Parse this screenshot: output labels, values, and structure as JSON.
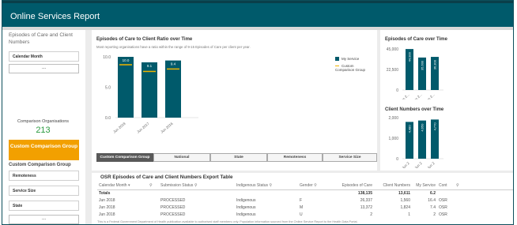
{
  "app": {
    "title": "Online Services Report"
  },
  "left_panel": {
    "episodes_title": "Episodes of Care and Client Numbers",
    "calendar_filter": "Calendar Month",
    "more_label": "...",
    "comparison_label": "Comparison Organisations",
    "comparison_count": "213",
    "custom_button": "Custom Comparison Group",
    "custom_group_title": "Custom Comparison Group",
    "filters": [
      "Remoteness",
      "Service Size",
      "State"
    ]
  },
  "ratio_chart": {
    "title": "Episodes of Care to Client Ratio over Time",
    "subtitle": "Most reporting organisations have a ratio within the range of 9-15 Episodes of Care per client per year.",
    "legend": [
      "My Service",
      "Custom Comparison Group"
    ],
    "colors": {
      "bar": "#005a6b",
      "line": "#f0b400"
    }
  },
  "chart_data": [
    {
      "type": "bar",
      "title": "Episodes of Care to Client Ratio over Time",
      "categories": [
        "Jun 2018",
        "Jun 2017",
        "Jun 2016"
      ],
      "series": [
        {
          "name": "My Service",
          "values": [
            10.0,
            9.1,
            9.4
          ]
        },
        {
          "name": "Custom Comparison Group",
          "values": [
            8.7,
            7.6,
            8.0
          ]
        }
      ],
      "yticks": [
        "10.0",
        "5.0",
        "0.0"
      ],
      "ylim": [
        0,
        10
      ]
    },
    {
      "type": "bar",
      "title": "Episodes of Care over Time",
      "categories": [
        "Jun 2...",
        "Jun 2...",
        "Jun 2..."
      ],
      "values": [
        44900,
        35600,
        36300
      ],
      "value_labels": [
        "44,900",
        "35,600",
        "36,300"
      ],
      "yticks": [
        "45,000",
        "22,500",
        "0"
      ],
      "ylim": [
        0,
        45000
      ]
    },
    {
      "type": "bar",
      "title": "Client Numbers over Time",
      "categories": [
        "Jun 2",
        "Jun 2",
        "Jun 2"
      ],
      "values": [
        4480,
        4650,
        4770
      ],
      "value_labels": [
        "4,480",
        "4,650",
        "4,770"
      ],
      "yticks": [
        "2,000",
        "1,000",
        "0"
      ],
      "ylim": [
        0,
        5000
      ]
    }
  ],
  "tabs": [
    "Custom Comparison Group",
    "National",
    "State",
    "Remoteness",
    "Service Size"
  ],
  "table": {
    "title": "OSR Episodes of Care and Client Numbers Export Table",
    "headers": [
      "Calendar Month",
      "Submission Status",
      "Indigenous Status",
      "Gender",
      "Episodes of Care",
      "Client Numbers",
      "My Service",
      "Cont"
    ],
    "total_row": [
      "Totals",
      "",
      "",
      "",
      "138,135",
      "13,611",
      "6.2",
      ""
    ],
    "rows": [
      [
        "Jun 2018",
        "PROCESSED",
        "Indigenous",
        "F",
        "26,337",
        "1,560",
        "16.4",
        "OSR"
      ],
      [
        "Jun 2018",
        "PROCESSED",
        "Indigenous",
        "M",
        "13,372",
        "1,824",
        "7.4",
        "OSR"
      ],
      [
        "Jun 2018",
        "PROCESSED",
        "Indigenous",
        "U",
        "2",
        "1",
        "2",
        "OSR"
      ]
    ]
  },
  "footnote": "This is a Federal Government Department of Health publication available to authorised staff members only. Population information sourced from the Online Service Report to the Health Data Portal."
}
